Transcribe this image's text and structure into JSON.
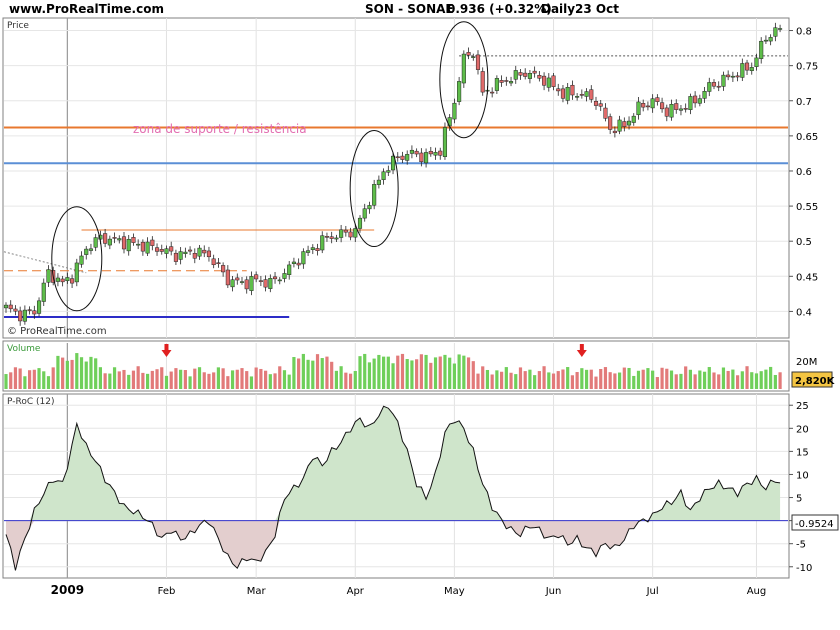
{
  "header": {
    "site": "www.ProRealTime.com",
    "symbol": "SON - SONAE",
    "quote": "0.936 (+0.32%)",
    "period": "Daily",
    "date": "23 Oct"
  },
  "chart_data": [
    {
      "type": "candlestick",
      "panel_label": "Price",
      "watermark": "© ProRealTime.com",
      "annotation": "zona de suporte / resistência",
      "y_ticks": [
        0.4,
        0.45,
        0.5,
        0.55,
        0.6,
        0.65,
        0.7,
        0.75,
        0.8
      ],
      "ylim": [
        0.365,
        0.815
      ],
      "x_labels": [
        "2009",
        "Feb",
        "Mar",
        "Apr",
        "May",
        "Jun",
        "Jul",
        "Aug"
      ],
      "x_label_index": [
        13,
        34,
        53,
        74,
        95,
        116,
        137,
        159
      ],
      "close_anchors": [
        [
          0,
          0.405
        ],
        [
          3,
          0.395
        ],
        [
          6,
          0.4
        ],
        [
          9,
          0.455
        ],
        [
          12,
          0.44
        ],
        [
          14,
          0.45
        ],
        [
          17,
          0.49
        ],
        [
          20,
          0.505
        ],
        [
          24,
          0.5
        ],
        [
          28,
          0.495
        ],
        [
          32,
          0.49
        ],
        [
          36,
          0.48
        ],
        [
          40,
          0.485
        ],
        [
          43,
          0.48
        ],
        [
          47,
          0.445
        ],
        [
          50,
          0.44
        ],
        [
          53,
          0.445
        ],
        [
          56,
          0.44
        ],
        [
          59,
          0.455
        ],
        [
          62,
          0.475
        ],
        [
          65,
          0.49
        ],
        [
          68,
          0.505
        ],
        [
          71,
          0.51
        ],
        [
          74,
          0.515
        ],
        [
          77,
          0.56
        ],
        [
          80,
          0.6
        ],
        [
          83,
          0.62
        ],
        [
          86,
          0.625
        ],
        [
          89,
          0.62
        ],
        [
          92,
          0.63
        ],
        [
          95,
          0.7
        ],
        [
          97,
          0.76
        ],
        [
          99,
          0.77
        ],
        [
          101,
          0.71
        ],
        [
          103,
          0.72
        ],
        [
          106,
          0.73
        ],
        [
          110,
          0.74
        ],
        [
          114,
          0.73
        ],
        [
          118,
          0.71
        ],
        [
          122,
          0.71
        ],
        [
          125,
          0.7
        ],
        [
          128,
          0.66
        ],
        [
          131,
          0.665
        ],
        [
          134,
          0.69
        ],
        [
          137,
          0.7
        ],
        [
          140,
          0.685
        ],
        [
          143,
          0.69
        ],
        [
          146,
          0.7
        ],
        [
          149,
          0.72
        ],
        [
          152,
          0.73
        ],
        [
          155,
          0.74
        ],
        [
          158,
          0.75
        ],
        [
          161,
          0.79
        ],
        [
          163,
          0.8
        ]
      ],
      "levels": [
        {
          "name": "resistance",
          "value": 0.662,
          "color": "#e8782f"
        },
        {
          "name": "support",
          "value": 0.611,
          "color": "#5b8fd6"
        },
        {
          "name": "mid-range",
          "value": 0.516,
          "color": "#e8782f"
        },
        {
          "name": "dashed-level",
          "value": 0.458,
          "color": "#e8782f"
        },
        {
          "name": "low-base",
          "value": 0.392,
          "color": "#2c2cc7"
        },
        {
          "name": "top-dotted",
          "value": 0.764,
          "color": "#555555"
        }
      ],
      "circled_phases": [
        "early-January",
        "April",
        "May"
      ],
      "colors": {
        "up": "#5ebd4a",
        "down": "#e06a6a",
        "outline": "#222222"
      }
    },
    {
      "type": "bar",
      "panel_label": "Volume",
      "y_ticks": [
        "20M"
      ],
      "last_value": "2,820K",
      "signals": [
        "late-January",
        "mid-June"
      ]
    },
    {
      "type": "area",
      "panel_label": "P-RoC (12)",
      "y_ticks": [
        25,
        20,
        15,
        10,
        5,
        0,
        -5,
        -10
      ],
      "ylim": [
        -12,
        27
      ],
      "last_value": "-0.9524",
      "anchors": [
        [
          0,
          -3
        ],
        [
          2,
          -10
        ],
        [
          4,
          -4
        ],
        [
          6,
          2
        ],
        [
          8,
          6
        ],
        [
          10,
          9
        ],
        [
          12,
          8
        ],
        [
          14,
          16
        ],
        [
          15,
          21
        ],
        [
          17,
          16
        ],
        [
          19,
          13
        ],
        [
          21,
          9
        ],
        [
          23,
          6
        ],
        [
          25,
          3
        ],
        [
          27,
          2
        ],
        [
          29,
          1
        ],
        [
          31,
          -1
        ],
        [
          33,
          -4
        ],
        [
          35,
          -2
        ],
        [
          37,
          -4
        ],
        [
          39,
          -3
        ],
        [
          41,
          -1
        ],
        [
          43,
          0
        ],
        [
          45,
          -4
        ],
        [
          47,
          -8
        ],
        [
          49,
          -10
        ],
        [
          51,
          -8
        ],
        [
          53,
          -9
        ],
        [
          55,
          -7
        ],
        [
          57,
          -3
        ],
        [
          59,
          5
        ],
        [
          61,
          7
        ],
        [
          63,
          9
        ],
        [
          65,
          14
        ],
        [
          67,
          12
        ],
        [
          69,
          15
        ],
        [
          71,
          17
        ],
        [
          73,
          20
        ],
        [
          75,
          22
        ],
        [
          77,
          20
        ],
        [
          79,
          23
        ],
        [
          81,
          25
        ],
        [
          83,
          21
        ],
        [
          85,
          15
        ],
        [
          87,
          8
        ],
        [
          89,
          5
        ],
        [
          91,
          10
        ],
        [
          93,
          19
        ],
        [
          95,
          22
        ],
        [
          97,
          20
        ],
        [
          99,
          15
        ],
        [
          101,
          8
        ],
        [
          103,
          3
        ],
        [
          105,
          0
        ],
        [
          107,
          -2
        ],
        [
          109,
          -3
        ],
        [
          111,
          -1
        ],
        [
          113,
          -2
        ],
        [
          115,
          -4
        ],
        [
          117,
          -3
        ],
        [
          119,
          -5
        ],
        [
          121,
          -4
        ],
        [
          123,
          -6
        ],
        [
          125,
          -7
        ],
        [
          127,
          -5
        ],
        [
          129,
          -6
        ],
        [
          131,
          -4
        ],
        [
          133,
          -1
        ],
        [
          135,
          0
        ],
        [
          137,
          1
        ],
        [
          139,
          3
        ],
        [
          141,
          4
        ],
        [
          143,
          6
        ],
        [
          145,
          2
        ],
        [
          147,
          5
        ],
        [
          149,
          7
        ],
        [
          151,
          8
        ],
        [
          153,
          7
        ],
        [
          155,
          6
        ],
        [
          157,
          8
        ],
        [
          159,
          9
        ],
        [
          161,
          7
        ],
        [
          163,
          9
        ],
        [
          164,
          8
        ]
      ],
      "colors": {
        "positive": "#cfe5cb",
        "negative": "#e3cece",
        "line": "#111111",
        "zero": "#3333cc"
      }
    }
  ]
}
